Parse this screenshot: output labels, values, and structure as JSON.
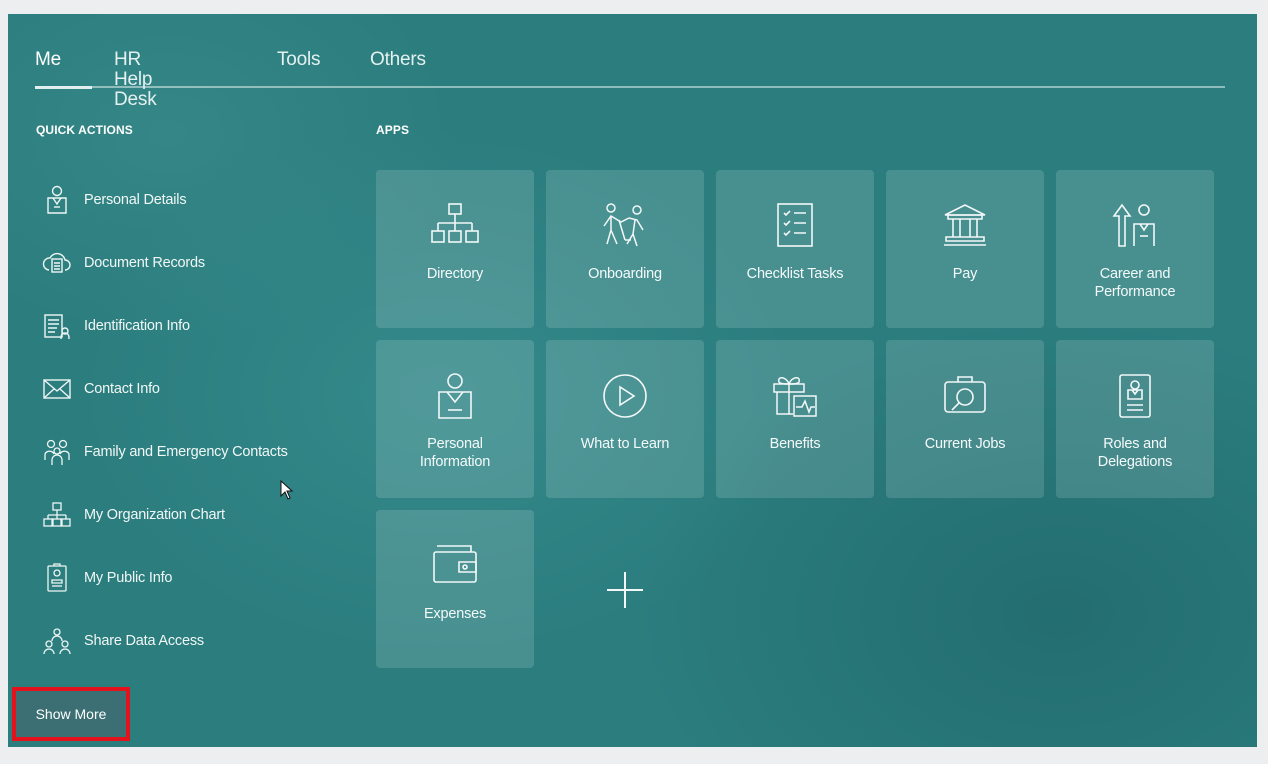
{
  "tabs": [
    {
      "label": "Me",
      "active": true
    },
    {
      "label": "HR Help Desk",
      "active": false
    },
    {
      "label": "Tools",
      "active": false
    },
    {
      "label": "Others",
      "active": false
    }
  ],
  "quick_actions": {
    "title": "QUICK ACTIONS",
    "items": [
      {
        "label": "Personal Details",
        "icon": "person-badge-icon"
      },
      {
        "label": "Document Records",
        "icon": "cloud-document-icon"
      },
      {
        "label": "Identification Info",
        "icon": "id-document-icon"
      },
      {
        "label": "Contact Info",
        "icon": "envelope-icon"
      },
      {
        "label": "Family and Emergency Contacts",
        "icon": "family-icon"
      },
      {
        "label": "My Organization Chart",
        "icon": "org-chart-icon"
      },
      {
        "label": "My Public Info",
        "icon": "badge-card-icon"
      },
      {
        "label": "Share Data Access",
        "icon": "share-people-icon"
      }
    ],
    "show_more_label": "Show More"
  },
  "apps": {
    "title": "APPS",
    "tiles": [
      {
        "line1": "Directory",
        "line2": "",
        "icon": "org-chart-icon"
      },
      {
        "line1": "Onboarding",
        "line2": "",
        "icon": "onboarding-people-icon"
      },
      {
        "line1": "Checklist Tasks",
        "line2": "",
        "icon": "checklist-icon"
      },
      {
        "line1": "Pay",
        "line2": "",
        "icon": "bank-icon"
      },
      {
        "line1": "Career and",
        "line2": "Performance",
        "icon": "career-arrow-person-icon"
      },
      {
        "line1": "Personal",
        "line2": "Information",
        "icon": "person-badge-icon"
      },
      {
        "line1": "What to Learn",
        "line2": "",
        "icon": "play-circle-icon"
      },
      {
        "line1": "Benefits",
        "line2": "",
        "icon": "gift-health-icon"
      },
      {
        "line1": "Current Jobs",
        "line2": "",
        "icon": "briefcase-search-icon"
      },
      {
        "line1": "Roles and",
        "line2": "Delegations",
        "icon": "id-badge-icon"
      },
      {
        "line1": "Expenses",
        "line2": "",
        "icon": "wallet-icon"
      }
    ],
    "add_icon": "plus-icon"
  },
  "colors": {
    "panel_bg": "#2b7d7e",
    "highlight_border": "#e3121b"
  }
}
